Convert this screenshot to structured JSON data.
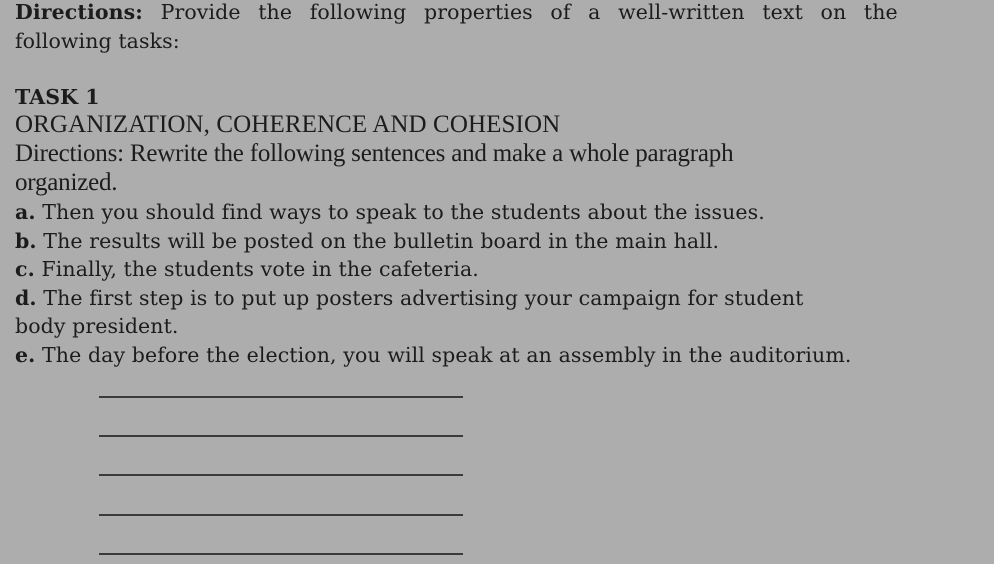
{
  "instructions": {
    "label": "Directions:",
    "text_line1": "Provide the following properties of a well-written text on the",
    "text_line2": "following tasks:"
  },
  "task": {
    "heading": "TASK 1",
    "section_title": "ORGANIZATION, COHERENCE AND COHESION",
    "directions_line1": "Directions: Rewrite the following sentences and make a whole paragraph",
    "directions_line2": "organized.",
    "items": [
      {
        "letter": "a.",
        "text": "Then you should find ways to speak to the students about the issues."
      },
      {
        "letter": "b.",
        "text": "The results will be posted on the bulletin board in the main hall."
      },
      {
        "letter": "c.",
        "text": "Finally, the students vote in the cafeteria."
      },
      {
        "letter": "d.",
        "text": "The first step is to put up posters advertising your campaign for student",
        "continuation": "body president."
      },
      {
        "letter": "e.",
        "text": "The day before the election, you will speak at an assembly in the auditorium."
      }
    ],
    "answer_lines": 5
  }
}
